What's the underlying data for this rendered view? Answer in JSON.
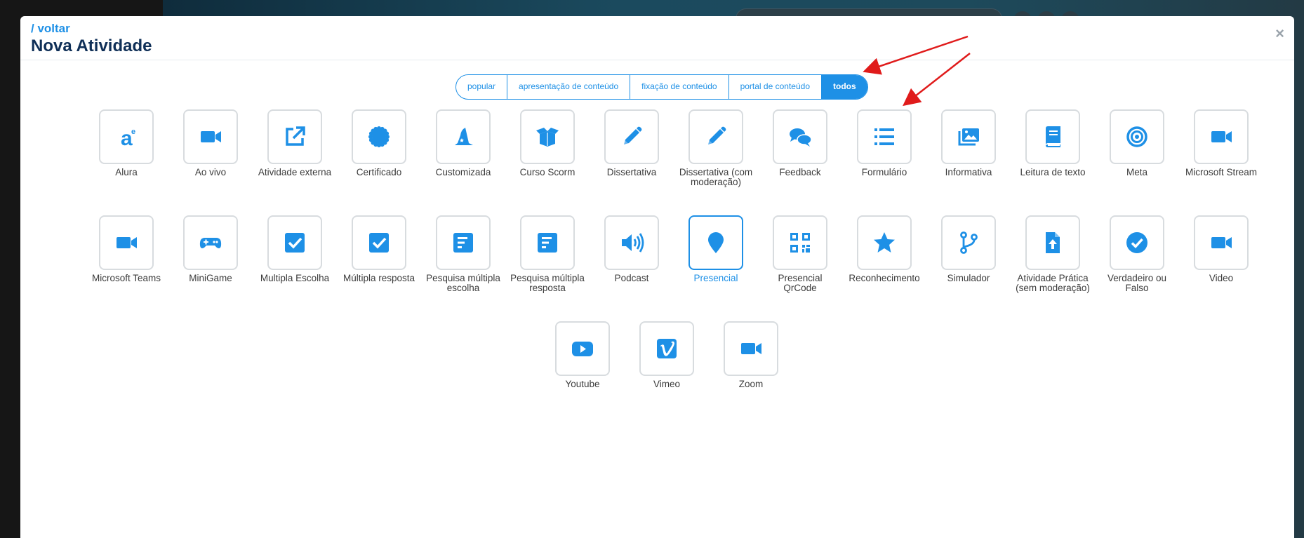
{
  "header": {
    "back_label": "/ voltar",
    "title": "Nova Atividade",
    "close_label": "×"
  },
  "filters": [
    {
      "label": "popular",
      "active": false
    },
    {
      "label": "apresentação de conteúdo",
      "active": false
    },
    {
      "label": "fixação de conteúdo",
      "active": false
    },
    {
      "label": "portal de conteúdo",
      "active": false
    },
    {
      "label": "todos",
      "active": true
    }
  ],
  "colors": {
    "accent": "#1e90e6",
    "title": "#0f2f57",
    "annotation_arrow": "#e01b1b"
  },
  "activities": [
    {
      "label": "Alura",
      "icon": "alura-logo-icon"
    },
    {
      "label": "Ao vivo",
      "icon": "video-camera-icon"
    },
    {
      "label": "Atividade externa",
      "icon": "external-link-icon"
    },
    {
      "label": "Certificado",
      "icon": "certificate-icon"
    },
    {
      "label": "Customizada",
      "icon": "wizard-hat-icon"
    },
    {
      "label": "Curso Scorm",
      "icon": "open-box-icon"
    },
    {
      "label": "Dissertativa",
      "icon": "pencil-icon"
    },
    {
      "label": "Dissertativa (com moderação)",
      "icon": "pencil-icon"
    },
    {
      "label": "Feedback",
      "icon": "chat-bubbles-icon"
    },
    {
      "label": "Formulário",
      "icon": "list-icon"
    },
    {
      "label": "Informativa",
      "icon": "images-icon"
    },
    {
      "label": "Leitura de texto",
      "icon": "book-icon"
    },
    {
      "label": "Meta",
      "icon": "target-icon"
    },
    {
      "label": "Microsoft Stream",
      "icon": "video-camera-icon"
    },
    {
      "label": "Microsoft Teams",
      "icon": "video-camera-icon"
    },
    {
      "label": "MiniGame",
      "icon": "gamepad-icon"
    },
    {
      "label": "Multipla Escolha",
      "icon": "checkbox-icon"
    },
    {
      "label": "Múltipla resposta",
      "icon": "checkbox-icon"
    },
    {
      "label": "Pesquisa múltipla escolha",
      "icon": "poll-icon"
    },
    {
      "label": "Pesquisa múltipla resposta",
      "icon": "poll-icon"
    },
    {
      "label": "Podcast",
      "icon": "speaker-icon"
    },
    {
      "label": "Presencial",
      "icon": "map-pin-icon",
      "selected": true
    },
    {
      "label": "Presencial QrCode",
      "icon": "qrcode-icon"
    },
    {
      "label": "Reconhecimento",
      "icon": "star-icon"
    },
    {
      "label": "Simulador",
      "icon": "branch-icon"
    },
    {
      "label": "Atividade Prática (sem moderação)",
      "icon": "file-upload-icon"
    },
    {
      "label": "Verdadeiro ou Falso",
      "icon": "check-circle-icon"
    },
    {
      "label": "Video",
      "icon": "video-camera-icon"
    },
    {
      "label": "Youtube",
      "icon": "youtube-icon"
    },
    {
      "label": "Vimeo",
      "icon": "vimeo-icon"
    },
    {
      "label": "Zoom",
      "icon": "video-camera-icon"
    }
  ]
}
